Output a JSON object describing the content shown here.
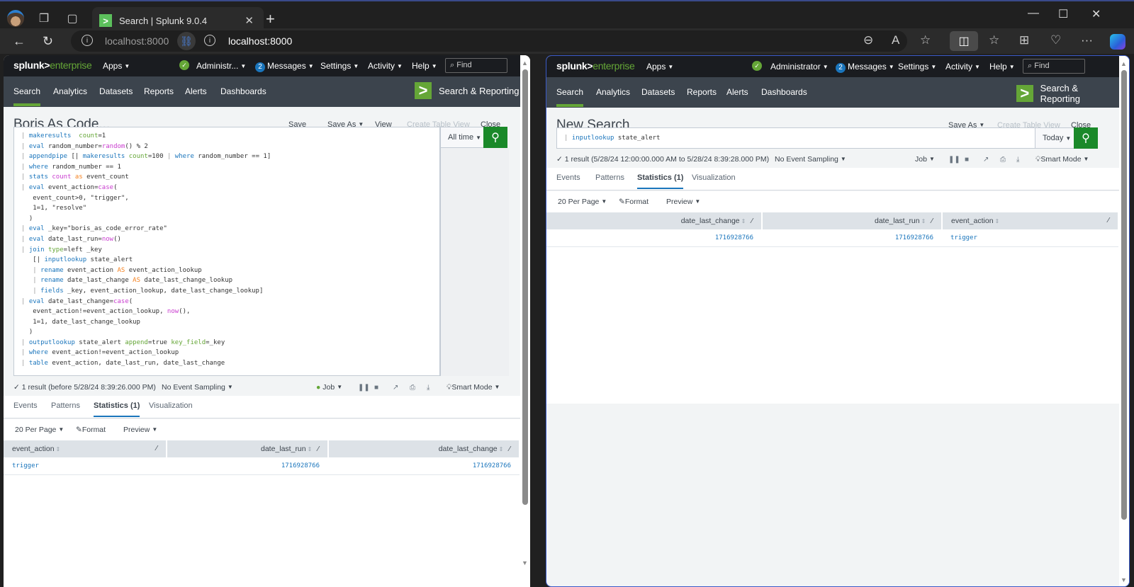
{
  "browser": {
    "tab_title": "Search | Splunk 9.0.4",
    "tab_favicon": ">",
    "left_url": "localhost:8000",
    "right_url": "localhost:8000",
    "icons": [
      "profile-avatar",
      "workspaces-icon",
      "vertical-tabs-icon",
      "close-icon",
      "new-tab-icon",
      "minimize-icon",
      "maximize-icon",
      "close-window-icon",
      "back-icon",
      "refresh-icon",
      "info-icon",
      "unlink-icon",
      "zoom-out-icon",
      "read-aloud-icon",
      "favorite-icon",
      "split-screen-icon",
      "favorites-list-icon",
      "collections-icon",
      "browser-essentials-icon",
      "more-icon",
      "copilot-icon"
    ]
  },
  "splunk_bar": {
    "logo_main": "splunk>",
    "logo_product": "enterprise",
    "apps": "Apps",
    "user_left": "Administr...",
    "user_right": "Administrator",
    "messages_count": "2",
    "messages": "Messages",
    "settings": "Settings",
    "activity": "Activity",
    "help": "Help",
    "find_placeholder": "Find"
  },
  "app_bar": {
    "nav": [
      "Search",
      "Analytics",
      "Datasets",
      "Reports",
      "Alerts",
      "Dashboards"
    ],
    "active": "Search",
    "app_title": "Search & Reporting",
    "app_logo": ">"
  },
  "left_pane": {
    "title": "Boris As Code...",
    "actions": {
      "save": "Save",
      "save_as": "Save As",
      "view": "View",
      "create_table_view": "Create Table View",
      "close": "Close"
    },
    "query_lines": [
      [
        [
          "pipe",
          "| "
        ],
        [
          "kw",
          "makeresults"
        ],
        [
          "",
          "  "
        ],
        [
          "arg",
          "count"
        ],
        [
          "",
          "=1"
        ]
      ],
      [
        [
          "pipe",
          "| "
        ],
        [
          "kw",
          "eval"
        ],
        [
          "",
          " random_number="
        ],
        [
          "fn",
          "random"
        ],
        [
          "",
          "() % 2"
        ]
      ],
      [
        [
          "pipe",
          "| "
        ],
        [
          "kw",
          "appendpipe"
        ],
        [
          "",
          " [| "
        ],
        [
          "kw",
          "makeresults"
        ],
        [
          "",
          " "
        ],
        [
          "arg",
          "count"
        ],
        [
          "",
          "=100 "
        ],
        [
          "pipe",
          "| "
        ],
        [
          "kw",
          "where"
        ],
        [
          "",
          " random_number == 1]"
        ]
      ],
      [
        [
          "pipe",
          "| "
        ],
        [
          "kw",
          "where"
        ],
        [
          "",
          " random_number == 1"
        ]
      ],
      [
        [
          "pipe",
          "| "
        ],
        [
          "kw",
          "stats"
        ],
        [
          "",
          " "
        ],
        [
          "fn",
          "count"
        ],
        [
          "",
          " "
        ],
        [
          "op",
          "as"
        ],
        [
          "",
          " event_count"
        ]
      ],
      [
        [
          "pipe",
          "| "
        ],
        [
          "kw",
          "eval"
        ],
        [
          "",
          " event_action="
        ],
        [
          "fn",
          "case"
        ],
        [
          "",
          "("
        ]
      ],
      [
        [
          "",
          "   event_count>0, \"trigger\","
        ]
      ],
      [
        [
          "",
          "   1=1, \"resolve\""
        ]
      ],
      [
        [
          "",
          "  )"
        ]
      ],
      [
        [
          "pipe",
          "| "
        ],
        [
          "kw",
          "eval"
        ],
        [
          "",
          " _key=\"boris_as_code_error_rate\""
        ]
      ],
      [
        [
          "pipe",
          "| "
        ],
        [
          "kw",
          "eval"
        ],
        [
          "",
          " date_last_run="
        ],
        [
          "fn",
          "now"
        ],
        [
          "",
          "()"
        ]
      ],
      [
        [
          "pipe",
          "| "
        ],
        [
          "kw",
          "join"
        ],
        [
          "",
          " "
        ],
        [
          "arg",
          "type"
        ],
        [
          "",
          "=left _key"
        ]
      ],
      [
        [
          "",
          "   [| "
        ],
        [
          "kw",
          "inputlookup"
        ],
        [
          "",
          " state_alert"
        ]
      ],
      [
        [
          "",
          "   "
        ],
        [
          "pipe",
          "| "
        ],
        [
          "kw",
          "rename"
        ],
        [
          "",
          " event_action "
        ],
        [
          "op",
          "AS"
        ],
        [
          "",
          " event_action_lookup"
        ]
      ],
      [
        [
          "",
          "   "
        ],
        [
          "pipe",
          "| "
        ],
        [
          "kw",
          "rename"
        ],
        [
          "",
          " date_last_change "
        ],
        [
          "op",
          "AS"
        ],
        [
          "",
          " date_last_change_lookup"
        ]
      ],
      [
        [
          "",
          "   "
        ],
        [
          "pipe",
          "| "
        ],
        [
          "kw",
          "fields"
        ],
        [
          "",
          " _key, event_action_lookup, date_last_change_lookup]"
        ]
      ],
      [
        [
          "pipe",
          "| "
        ],
        [
          "kw",
          "eval"
        ],
        [
          "",
          " date_last_change="
        ],
        [
          "fn",
          "case"
        ],
        [
          "",
          "("
        ]
      ],
      [
        [
          "",
          "   event_action!=event_action_lookup, "
        ],
        [
          "fn",
          "now"
        ],
        [
          "",
          "(),"
        ]
      ],
      [
        [
          "",
          "   1=1, date_last_change_lookup"
        ]
      ],
      [
        [
          "",
          "  )"
        ]
      ],
      [
        [
          "pipe",
          "| "
        ],
        [
          "kw",
          "outputlookup"
        ],
        [
          "",
          " state_alert "
        ],
        [
          "arg",
          "append"
        ],
        [
          "",
          "=true "
        ],
        [
          "arg",
          "key_field"
        ],
        [
          "",
          "=_key"
        ]
      ],
      [
        [
          "pipe",
          "| "
        ],
        [
          "kw",
          "where"
        ],
        [
          "",
          " event_action!=event_action_lookup"
        ]
      ],
      [
        [
          "pipe",
          "| "
        ],
        [
          "kw",
          "table"
        ],
        [
          "",
          " event_action, date_last_run, date_last_change"
        ]
      ]
    ],
    "time_range": "All time",
    "status": "✓ 1 result (before 5/28/24 8:39:26.000 PM)",
    "sampling": "No Event Sampling",
    "job": "Job",
    "mode": "Smart Mode",
    "tabs": [
      "Events",
      "Patterns",
      "Statistics (1)",
      "Visualization"
    ],
    "active_tab": "Statistics (1)",
    "per_page": "20 Per Page",
    "format": "Format",
    "preview": "Preview",
    "table": {
      "columns": [
        "event_action",
        "date_last_run",
        "date_last_change"
      ],
      "rows": [
        [
          "trigger",
          "1716928766",
          "1716928766"
        ]
      ]
    }
  },
  "right_pane": {
    "title": "New Search",
    "actions": {
      "save_as": "Save As",
      "create_table_view": "Create Table View",
      "close": "Close"
    },
    "query_lines": [
      [
        [
          "pipe",
          "| "
        ],
        [
          "kw",
          "inputlookup"
        ],
        [
          "",
          " state_alert"
        ]
      ]
    ],
    "time_range": "Today",
    "status": "✓ 1 result (5/28/24 12:00:00.000 AM to 5/28/24 8:39:28.000 PM)",
    "sampling": "No Event Sampling",
    "job": "Job",
    "mode": "Smart Mode",
    "tabs": [
      "Events",
      "Patterns",
      "Statistics (1)",
      "Visualization"
    ],
    "active_tab": "Statistics (1)",
    "per_page": "20 Per Page",
    "format": "Format",
    "preview": "Preview",
    "table": {
      "columns": [
        "date_last_change",
        "date_last_run",
        "event_action"
      ],
      "rows": [
        [
          "1716928766",
          "1716928766",
          "trigger"
        ]
      ]
    }
  },
  "colors": {
    "splunk_green": "#65a637",
    "search_green": "#1a8929",
    "link_blue": "#1a75bc",
    "app_bar": "#3c444d",
    "splunk_bar": "#1a1c20"
  }
}
